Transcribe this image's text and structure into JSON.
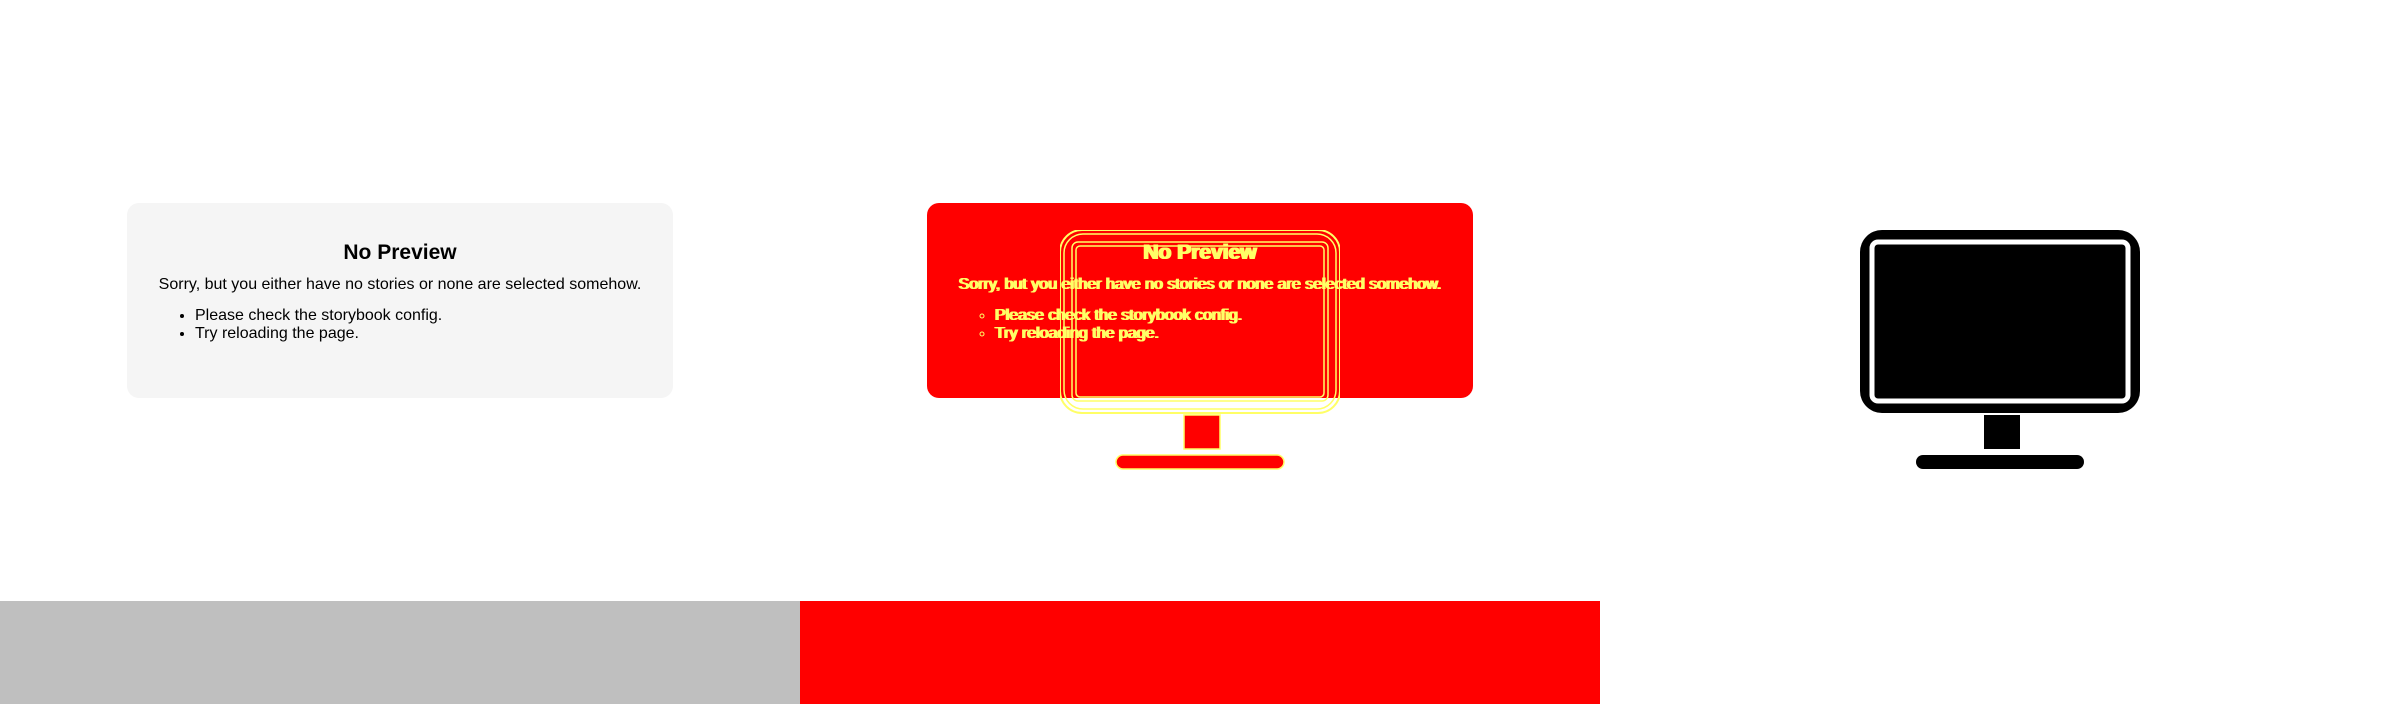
{
  "preview": {
    "title": "No Preview",
    "message": "Sorry, but you either have no stories or none are selected somehow.",
    "hints": [
      "Please check the storybook config.",
      "Try reloading the page."
    ]
  },
  "icons": {
    "monitor": "monitor-icon"
  },
  "colors": {
    "page_background": "#ffffff",
    "card_light": "#f5f5f5",
    "card_red": "#ff0000",
    "text_dark": "#000000",
    "text_outline": "#ffff66",
    "strip_left": "#bfbfbf",
    "strip_mid": "#ff0000",
    "monitor_fill": "#000000"
  }
}
